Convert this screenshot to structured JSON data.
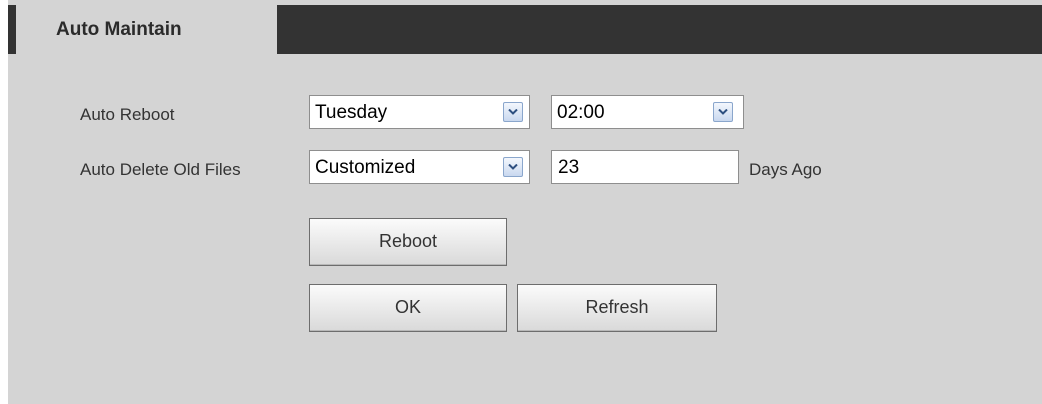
{
  "tab": {
    "title": "Auto Maintain"
  },
  "auto_reboot": {
    "label": "Auto Reboot",
    "day": "Tuesday",
    "time": "02:00"
  },
  "auto_delete": {
    "label": "Auto Delete Old Files",
    "mode": "Customized",
    "days": "23",
    "unit": "Days Ago"
  },
  "buttons": {
    "reboot": "Reboot",
    "ok": "OK",
    "refresh": "Refresh"
  },
  "colors": {
    "panel_bg": "#d4d4d4",
    "header_bar": "#333333",
    "text": "#333333"
  },
  "icons": {
    "dropdown": "chevron-down-icon"
  }
}
